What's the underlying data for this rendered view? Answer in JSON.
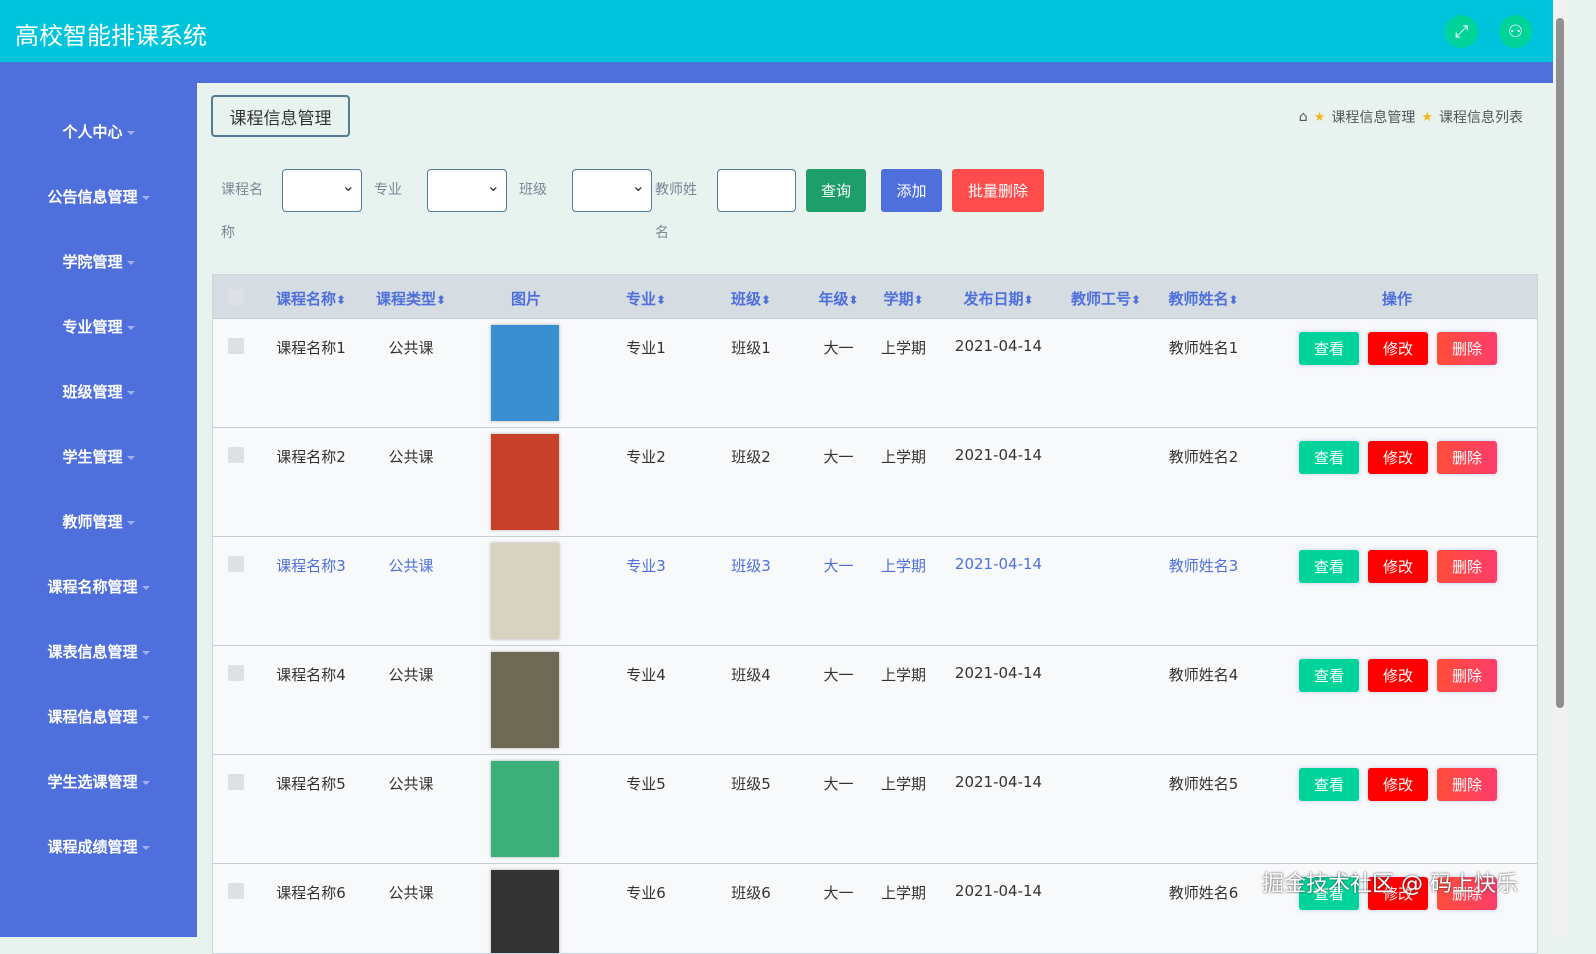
{
  "header": {
    "title": "高校智能排课系统",
    "icons": [
      "fullscreen-icon",
      "user-icon"
    ]
  },
  "sidebar": {
    "items": [
      "个人中心",
      "公告信息管理",
      "学院管理",
      "专业管理",
      "班级管理",
      "学生管理",
      "教师管理",
      "课程名称管理",
      "课表信息管理",
      "课程信息管理",
      "学生选课管理",
      "课程成绩管理"
    ]
  },
  "page": {
    "title": "课程信息管理",
    "breadcrumb": [
      "课程信息管理",
      "课程信息列表"
    ]
  },
  "search": {
    "labels": {
      "course_name": "课程名称",
      "major": "专业",
      "class": "班级",
      "teacher_name": "教师姓名"
    },
    "query": "查询",
    "add": "添加",
    "batch_delete": "批量删除"
  },
  "colors": {
    "header": "#00c4dc",
    "sidebar": "#4e6fdc",
    "view": "#00d49a",
    "edit": "#ff0000",
    "delete": "#ff4d4d"
  },
  "table": {
    "columns": [
      "课程名称",
      "课程类型",
      "图片",
      "专业",
      "班级",
      "年级",
      "学期",
      "发布日期",
      "教师工号",
      "教师姓名",
      "操作"
    ],
    "actions": {
      "view": "查看",
      "edit": "修改",
      "delete": "删除"
    },
    "rows": [
      {
        "name": "课程名称1",
        "type": "公共课",
        "major": "专业1",
        "class": "班级1",
        "grade": "大一",
        "term": "上学期",
        "date": "2021-04-14",
        "teacher_no": "",
        "teacher": "教师姓名1",
        "cover": "#3a8fd0"
      },
      {
        "name": "课程名称2",
        "type": "公共课",
        "major": "专业2",
        "class": "班级2",
        "grade": "大一",
        "term": "上学期",
        "date": "2021-04-14",
        "teacher_no": "",
        "teacher": "教师姓名2",
        "cover": "#c9402a"
      },
      {
        "name": "课程名称3",
        "type": "公共课",
        "major": "专业3",
        "class": "班级3",
        "grade": "大一",
        "term": "上学期",
        "date": "2021-04-14",
        "teacher_no": "",
        "teacher": "教师姓名3",
        "cover": "#d8d2c0"
      },
      {
        "name": "课程名称4",
        "type": "公共课",
        "major": "专业4",
        "class": "班级4",
        "grade": "大一",
        "term": "上学期",
        "date": "2021-04-14",
        "teacher_no": "",
        "teacher": "教师姓名4",
        "cover": "#6f6a55"
      },
      {
        "name": "课程名称5",
        "type": "公共课",
        "major": "专业5",
        "class": "班级5",
        "grade": "大一",
        "term": "上学期",
        "date": "2021-04-14",
        "teacher_no": "",
        "teacher": "教师姓名5",
        "cover": "#3bb07a"
      },
      {
        "name": "课程名称6",
        "type": "公共课",
        "major": "专业6",
        "class": "班级6",
        "grade": "大一",
        "term": "上学期",
        "date": "2021-04-14",
        "teacher_no": "",
        "teacher": "教师姓名6",
        "cover": "#333333"
      }
    ]
  },
  "watermark": "掘金技术社区 @ 码上快乐"
}
